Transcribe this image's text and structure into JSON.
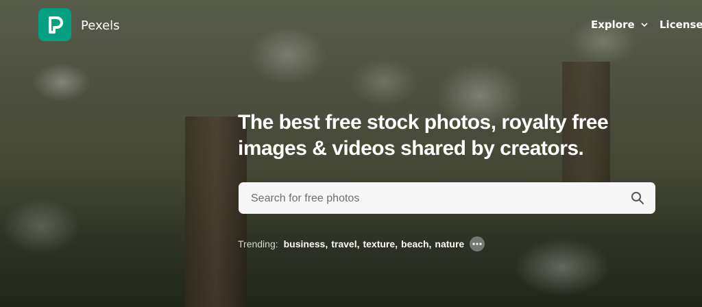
{
  "brand": {
    "name": "Pexels",
    "color": "#05a081"
  },
  "nav": {
    "explore_label": "Explore",
    "license_label": "License"
  },
  "hero": {
    "headline_line1": "The best free stock photos, royalty free",
    "headline_line2": "images & videos shared by creators."
  },
  "search": {
    "placeholder": "Search for free photos",
    "icon": "search-icon"
  },
  "trending": {
    "label": "Trending:",
    "items": [
      "business",
      "travel",
      "texture",
      "beach",
      "nature"
    ],
    "more_icon": "more-dots-icon"
  }
}
